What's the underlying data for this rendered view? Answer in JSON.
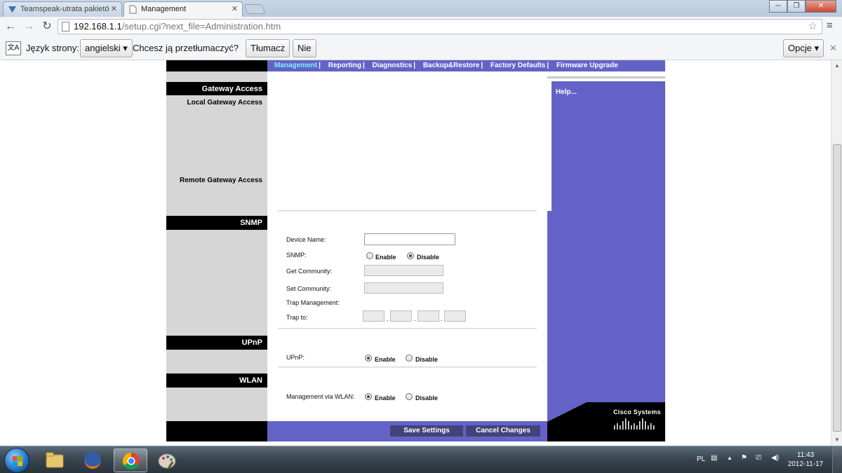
{
  "browser": {
    "tabs": [
      {
        "title": "Teamspeak-utrata pakietó",
        "active": false
      },
      {
        "title": "Management",
        "active": true
      }
    ],
    "url_host": "192.168.1.1",
    "url_path": "/setup.cgi?next_file=Administration.htm",
    "translate_bar": {
      "label_language": "Język strony:",
      "language_value": "angielski",
      "question": "Chcesz ją przetłumaczyć?",
      "translate_button": "Tłumacz",
      "no_button": "Nie",
      "options_button": "Opcje"
    }
  },
  "router": {
    "nav": [
      {
        "label": "Management",
        "active": true
      },
      {
        "label": "Reporting",
        "active": false
      },
      {
        "label": "Diagnostics",
        "active": false
      },
      {
        "label": "Backup&Restore",
        "active": false
      },
      {
        "label": "Factory Defaults",
        "active": false
      },
      {
        "label": "Firmware Upgrade",
        "active": false
      }
    ],
    "nav_separator": "|",
    "sections": {
      "gateway_access": {
        "title": "Gateway Access",
        "local_label": "Local Gateway Access",
        "remote_label": "Remote Gateway Access"
      },
      "snmp": {
        "title": "SNMP",
        "device_name_label": "Device Name:",
        "device_name_value": "",
        "snmp_label": "SNMP:",
        "enable_label": "Enable",
        "disable_label": "Disable",
        "snmp_selected": "Disable",
        "get_community_label": "Get Community:",
        "get_community_value": "",
        "set_community_label": "Set Community:",
        "set_community_value": "",
        "trap_management_label": "Trap Management:",
        "trap_to_label": "Trap to:",
        "trap_octets": [
          "",
          "",
          "",
          ""
        ],
        "dot": "."
      },
      "upnp": {
        "title": "UPnP",
        "upnp_label": "UPnP:",
        "enable_label": "Enable",
        "disable_label": "Disable",
        "selected": "Enable"
      },
      "wlan": {
        "title": "WLAN",
        "mgmt_label": "Management via WLAN:",
        "enable_label": "Enable",
        "disable_label": "Disable",
        "selected": "Enable"
      }
    },
    "help_link": "Help...",
    "save_button": "Save Settings",
    "cancel_button": "Cancel Changes",
    "brand": "Cisco Systems"
  },
  "taskbar": {
    "language": "PL",
    "time": "11:43",
    "date": "2012-11-17"
  },
  "colors": {
    "accent_purple": "#6363c7",
    "active_nav": "#7cf2ff"
  }
}
